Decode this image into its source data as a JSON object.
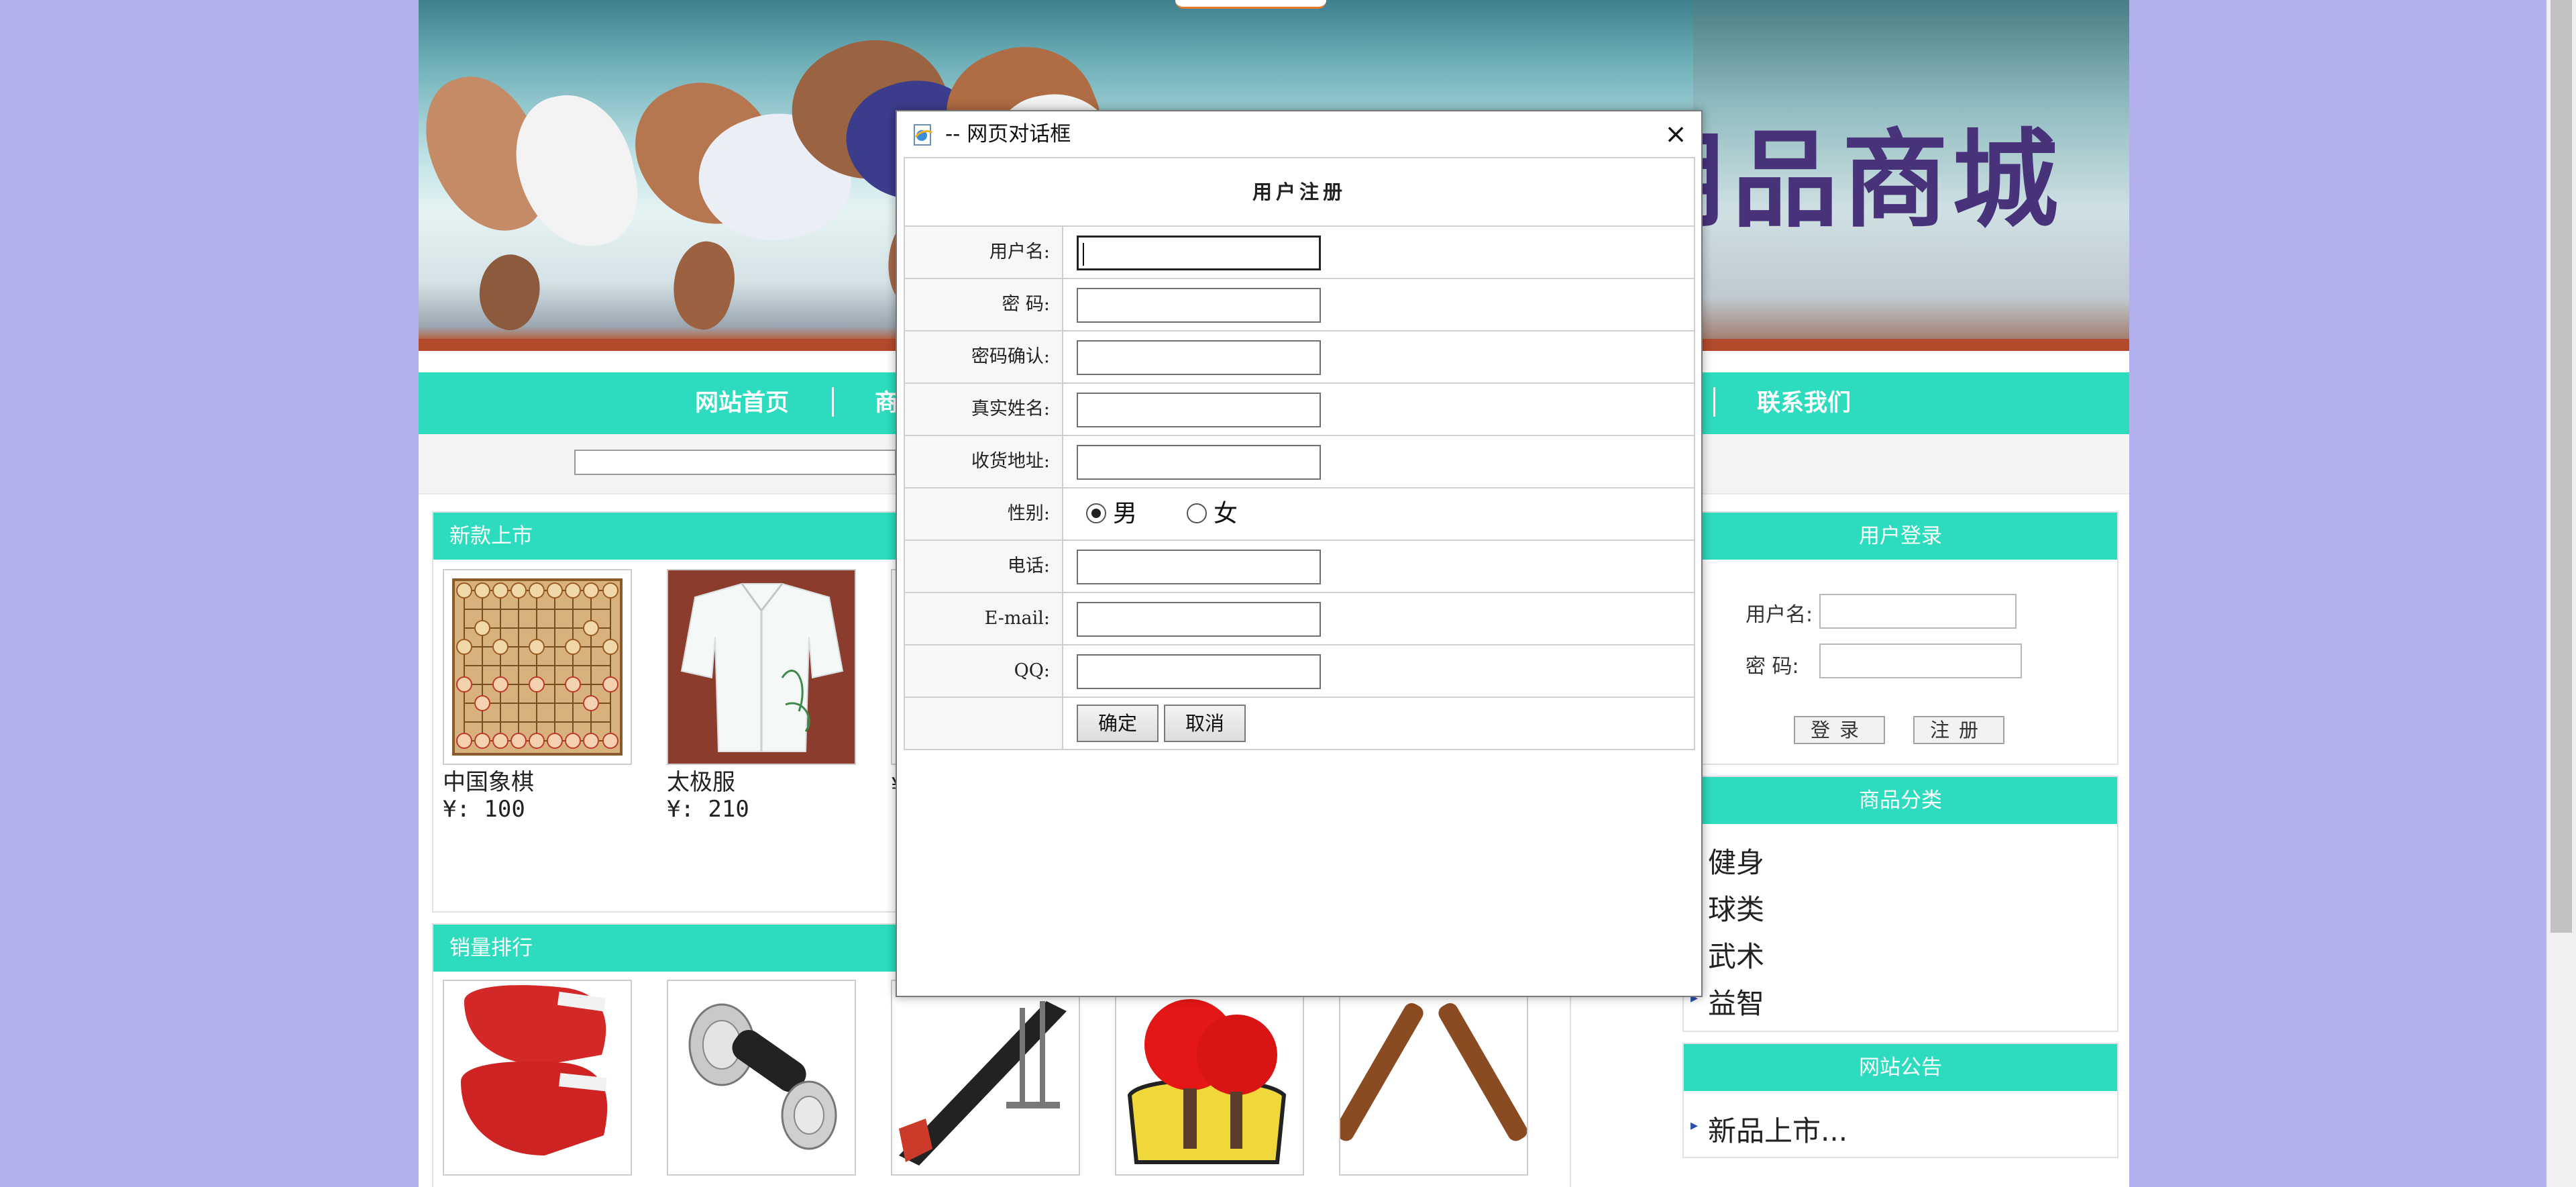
{
  "site": {
    "banner_title": "用品商城",
    "nav": [
      "网站首页",
      "商",
      "联系我们"
    ],
    "colors": {
      "accent": "#2ddcbe",
      "page_bg": "#b3b0ee",
      "banner_title": "#48327a"
    }
  },
  "new_arrivals": {
    "title": "新款上市",
    "products": [
      {
        "name": "中国象棋",
        "price": "¥: 100"
      },
      {
        "name": "太极服",
        "price": "¥: 210"
      }
    ],
    "partial_price": "¥"
  },
  "best_sellers": {
    "title": "销量排行"
  },
  "login": {
    "title": "用户登录",
    "username_label": "用户名:",
    "password_label": "密  码:",
    "login_button": "登录",
    "register_button": "注册"
  },
  "categories": {
    "title": "商品分类",
    "items": [
      "健身",
      "球类",
      "武术",
      "益智"
    ]
  },
  "notice": {
    "title": "网站公告",
    "items": [
      "新品上市..."
    ]
  },
  "dialog": {
    "title": "-- 网页对话框",
    "close_icon": "×",
    "form_title": "用户注册",
    "fields": {
      "username": "用户名:",
      "password": "密  码:",
      "confirm_password": "密码确认:",
      "real_name": "真实姓名:",
      "address": "收货地址:",
      "gender": "性别:",
      "phone": "电话:",
      "email": "E-mail:",
      "qq": "QQ:"
    },
    "gender_options": {
      "male": "男",
      "female": "女",
      "selected": "男"
    },
    "confirm_button": "确定",
    "cancel_button": "取消"
  }
}
